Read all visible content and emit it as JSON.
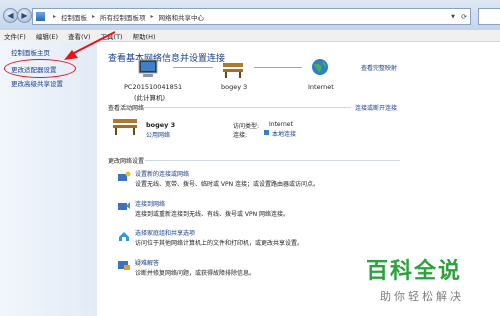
{
  "address_bar": {
    "crumbs": [
      "控制面板",
      "所有控制面板项",
      "网络和共享中心"
    ]
  },
  "menu": [
    "文件(F)",
    "编辑(E)",
    "查看(V)",
    "工具(T)",
    "帮助(H)"
  ],
  "sidebar": {
    "items": [
      "控制面板主页",
      "更改适配器设置",
      "更改高级共享设置"
    ]
  },
  "main": {
    "heading": "查看基本网络信息并设置连接",
    "view_full_map": "查看完整映射",
    "computer_name": "PC201510041851",
    "computer_sub": "(此计算机)",
    "network_name": "bogey 3",
    "internet": "Internet",
    "active_title": "查看活动网络",
    "connect_disconnect": "连接或断开连接",
    "active_network": "bogey 3",
    "network_type": "公用网络",
    "access_type_label": "访问类型:",
    "access_type_value": "Internet",
    "connection_label": "连接:",
    "connection_value": "本地连接",
    "change_title": "更改网络设置",
    "tasks": [
      {
        "link": "设置新的连接或网络",
        "desc": "设置无线、宽带、拨号、临时或 VPN 连接；或设置路由器或访问点。"
      },
      {
        "link": "连接到网络",
        "desc": "连接到或重新连接到无线、有线、拨号或 VPN 网络连接。"
      },
      {
        "link": "选择家庭组和共享选项",
        "desc": "访问位于其他网络计算机上的文件和打印机，或更改共享设置。"
      },
      {
        "link": "疑难解答",
        "desc": "诊断并修复网络问题，或获得故障排除信息。"
      }
    ]
  },
  "watermark": {
    "brand": "百科全说",
    "tagline": "助你轻松解决"
  }
}
